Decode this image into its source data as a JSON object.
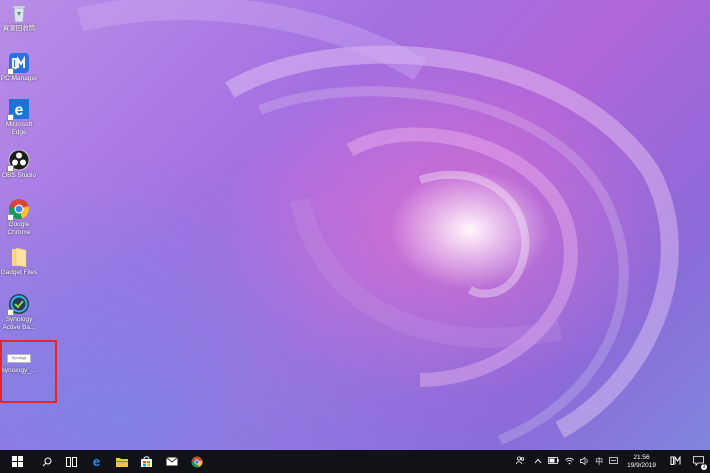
{
  "desktop": {
    "icons": [
      {
        "name": "recycle-bin",
        "label": "資源回收筒"
      },
      {
        "name": "pc-manager",
        "label": "PC Manager"
      },
      {
        "name": "microsoft-edge",
        "label": "Microsoft Edge"
      },
      {
        "name": "obs-studio",
        "label": "OBS Studio"
      },
      {
        "name": "google-chrome",
        "label": "Google Chrome"
      },
      {
        "name": "gadget-files",
        "label": "Gadget Files"
      },
      {
        "name": "synology-active-backup",
        "label": "Synology Active Ba..."
      },
      {
        "name": "synology-file",
        "label": "synology_..."
      }
    ],
    "thumbnail_text": "Synology"
  },
  "taskbar": {
    "apps": [
      "windows-start",
      "search",
      "task-view",
      "edge",
      "file-explorer",
      "store",
      "mail",
      "chrome"
    ],
    "tray": {
      "ime": "中",
      "time": "21:56",
      "date": "19/9/2019",
      "notification_count": "3"
    }
  },
  "colors": {
    "highlight": "#e5262b",
    "taskbar": "#101217"
  }
}
